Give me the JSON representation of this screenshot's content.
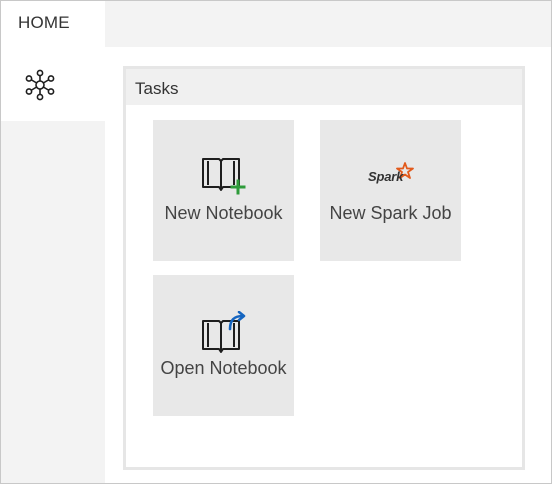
{
  "tabs": [
    {
      "label": "HOME"
    }
  ],
  "sidebar": {
    "items": [
      {
        "icon": "network-icon"
      }
    ]
  },
  "panel": {
    "title": "Tasks"
  },
  "tasks": [
    {
      "label": "New Notebook",
      "icon": "new-notebook-icon"
    },
    {
      "label": "New Spark Job",
      "icon": "spark-logo-icon",
      "logo_text": "Spark"
    },
    {
      "label": "Open Notebook",
      "icon": "open-notebook-icon"
    }
  ],
  "colors": {
    "plus": "#2e9b3a",
    "arrow": "#1565c0",
    "spark_star": "#e25a1c",
    "tile_bg": "#e8e8e8"
  }
}
